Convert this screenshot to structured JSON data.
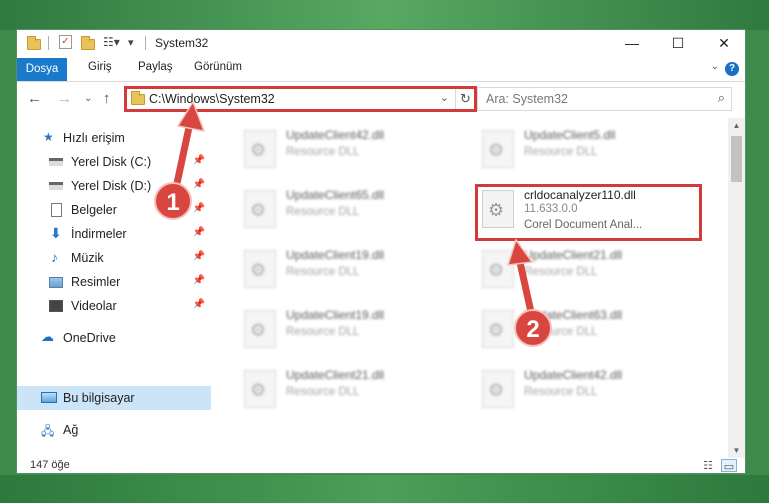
{
  "window": {
    "title": "System32",
    "controls": {
      "minimize": "—",
      "maximize": "☐",
      "close": "✕"
    }
  },
  "ribbon": {
    "tabs": [
      "Dosya",
      "Giriş",
      "Paylaş",
      "Görünüm"
    ],
    "help": "?"
  },
  "nav": {
    "address": "C:\\Windows\\System32",
    "search_placeholder": "Ara: System32"
  },
  "sidebar": {
    "items": [
      {
        "label": "Hızlı erişim",
        "icon": "star-icon"
      },
      {
        "label": "Yerel Disk (C:)",
        "icon": "drive-icon",
        "pinned": true
      },
      {
        "label": "Yerel Disk (D:)",
        "icon": "drive-icon",
        "pinned": true
      },
      {
        "label": "Belgeler",
        "icon": "documents-icon",
        "pinned": true
      },
      {
        "label": "İndirmeler",
        "icon": "download-icon",
        "pinned": true
      },
      {
        "label": "Müzik",
        "icon": "music-icon",
        "pinned": true
      },
      {
        "label": "Resimler",
        "icon": "pictures-icon",
        "pinned": true
      },
      {
        "label": "Videolar",
        "icon": "videos-icon",
        "pinned": true
      },
      {
        "label": "OneDrive",
        "icon": "cloud-icon"
      },
      {
        "label": "Bu bilgisayar",
        "icon": "computer-icon",
        "selected": true
      },
      {
        "label": "Ağ",
        "icon": "network-icon"
      }
    ]
  },
  "files": [
    {
      "name": "UpdateClient42.dll",
      "desc": "Resource DLL"
    },
    {
      "name": "UpdateClient5.dll",
      "desc": "Resource DLL"
    },
    {
      "name": "UpdateClient65.dll",
      "desc": "Resource DLL"
    },
    {
      "name": "crldocanalyzer110.dll",
      "version": "11.633.0.0",
      "desc": "Corel Document Anal..."
    },
    {
      "name": "UpdateClient19.dll",
      "desc": "Resource DLL"
    },
    {
      "name": "UpdateClient21.dll",
      "desc": "Resource DLL"
    },
    {
      "name": "UpdateClient19.dll",
      "desc": "Resource DLL"
    },
    {
      "name": "UpdateClient63.dll",
      "desc": "Resource DLL"
    },
    {
      "name": "UpdateClient21.dll",
      "desc": "Resource DLL"
    },
    {
      "name": "UpdateClient42.dll",
      "desc": "Resource DLL"
    }
  ],
  "status": {
    "count": "147 öğe"
  },
  "annotations": {
    "step1": "1",
    "step2": "2"
  },
  "colors": {
    "accent": "#1979ca",
    "highlight": "#d33b3b",
    "selected": "#cce4f7"
  }
}
